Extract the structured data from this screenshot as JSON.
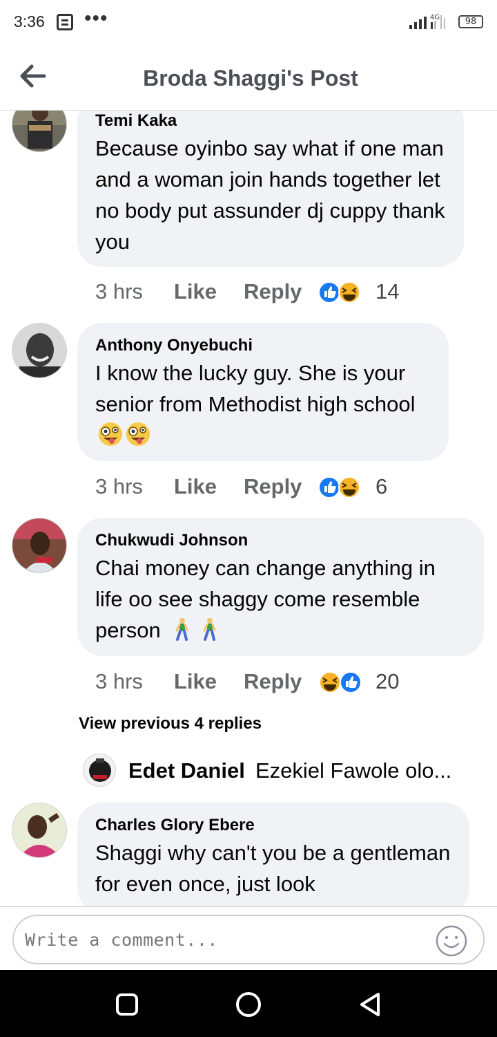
{
  "status_bar": {
    "time": "3:36",
    "network": "4G",
    "battery": "98"
  },
  "header": {
    "title": "Broda Shaggi's Post"
  },
  "comments": [
    {
      "author": "Temi Kaka",
      "text": "Because oyinbo say what if one man and a woman join hands together let no body put assunder dj cuppy thank you",
      "time": "3 hrs",
      "like_label": "Like",
      "reply_label": "Reply",
      "reactions": [
        "like",
        "haha"
      ],
      "reaction_count": "14"
    },
    {
      "author": "Anthony Onyebuchi",
      "text": "I know the lucky guy. She is your senior from Methodist high school",
      "text_emojis": [
        "zany-face",
        "zany-face"
      ],
      "time": "3 hrs",
      "like_label": "Like",
      "reply_label": "Reply",
      "reactions": [
        "like",
        "haha"
      ],
      "reaction_count": "6"
    },
    {
      "author": "Chukwudi Johnson",
      "text": "Chai money can change anything in life oo see shaggy come resemble person",
      "text_emojis": [
        "walking-person",
        "walking-person"
      ],
      "time": "3 hrs",
      "like_label": "Like",
      "reply_label": "Reply",
      "reactions": [
        "haha",
        "like"
      ],
      "reaction_count": "20"
    },
    {
      "author": "Charles Glory Ebere",
      "text": "Shaggi why can't you be a gentleman for even once, just look"
    }
  ],
  "view_previous": "View previous 4 replies",
  "reply_preview": {
    "author": "Edet Daniel",
    "text": "Ezekiel Fawole olo..."
  },
  "composer": {
    "placeholder": "Write a comment..."
  },
  "colors": {
    "bubble": "#f0f2f5",
    "like_blue": "#1877f2",
    "haha_yellow": "#f7b125",
    "meta_gray": "#65676b"
  }
}
